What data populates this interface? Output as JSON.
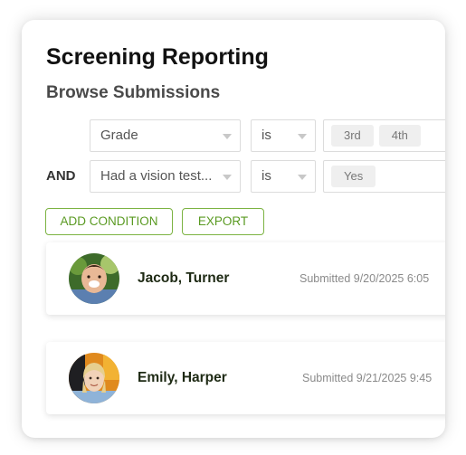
{
  "page": {
    "title": "Screening Reporting",
    "subtitle": "Browse Submissions"
  },
  "filters": {
    "row1": {
      "field": "Grade",
      "operator": "is",
      "values": [
        "3rd",
        "4th"
      ]
    },
    "row2": {
      "connector": "AND",
      "field": "Had a vision test...",
      "operator": "is",
      "values": [
        "Yes"
      ]
    }
  },
  "actions": {
    "add_condition": "ADD CONDITION",
    "export": "EXPORT"
  },
  "submissions": [
    {
      "name": "Jacob, Turner",
      "submitted": "Submitted 9/20/2025 6:05"
    },
    {
      "name": "Emily, Harper",
      "submitted": "Submitted 9/21/2025 9:45"
    }
  ],
  "colors": {
    "accent_green": "#7cb342",
    "accent_green_text": "#5a9a22",
    "name_text": "#1e2a14"
  },
  "icons": {
    "dropdown": "chevron-down-icon"
  }
}
